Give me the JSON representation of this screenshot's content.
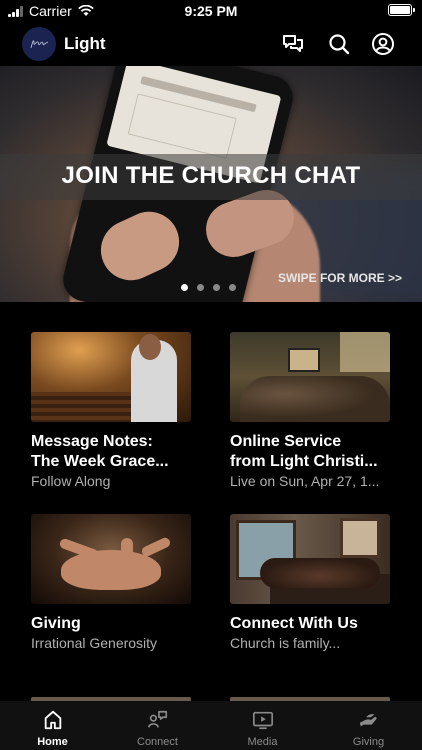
{
  "status_bar": {
    "carrier": "Carrier",
    "time": "9:25 PM"
  },
  "app": {
    "title": "Light",
    "logo_text": "light"
  },
  "header_icons": [
    "chat-icon",
    "search-icon",
    "account-icon"
  ],
  "hero": {
    "title": "JOIN THE CHURCH CHAT",
    "swipe_hint": "SWIPE FOR MORE >>",
    "page_count": 4,
    "active_page": 1
  },
  "cards": [
    {
      "title_line1": "Message Notes:",
      "title_line2": "The Week Grace...",
      "subtitle": "Follow Along"
    },
    {
      "title_line1": "Online Service",
      "title_line2": "from Light Christi...",
      "subtitle": "Live on Sun, Apr 27, 1..."
    },
    {
      "title_line1": "Giving",
      "title_line2": "",
      "subtitle": "Irrational Generosity"
    },
    {
      "title_line1": "Connect With Us",
      "title_line2": "",
      "subtitle": "Church is family..."
    }
  ],
  "tabs": [
    {
      "label": "Home",
      "icon": "home-icon",
      "active": true
    },
    {
      "label": "Connect",
      "icon": "connect-icon",
      "active": false
    },
    {
      "label": "Media",
      "icon": "media-icon",
      "active": false
    },
    {
      "label": "Giving",
      "icon": "giving-icon",
      "active": false
    }
  ],
  "colors": {
    "background": "#000000",
    "tab_bar": "#111111",
    "inactive_tab": "#8a8a8a",
    "logo_bg": "#1b2450"
  }
}
